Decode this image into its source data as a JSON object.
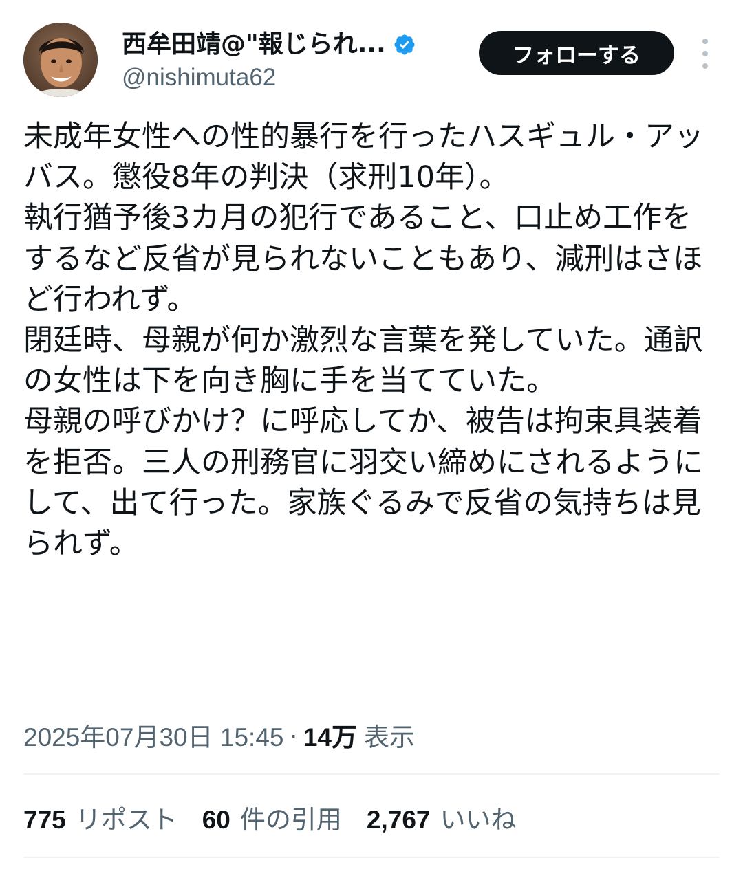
{
  "author": {
    "display_name": "西牟田靖@\"報じられ...",
    "handle": "@nishimuta62",
    "verified": true,
    "verified_color": "#1d9bf0"
  },
  "actions": {
    "follow_label": "フォローする",
    "more_icon": "more-vertical-icon"
  },
  "tweet": {
    "text": "未成年女性への性的暴行を行ったハスギュル・アッバス。懲役8年の判決（求刑10年）。\n執行猶予後3カ月の犯行であること、口止め工作をするなど反省が見られないこともあり、減刑はさほど行われず。\n閉廷時、母親が何か激烈な言葉を発していた。通訳の女性は下を向き胸に手を当てていた。\n母親の呼びかけ？に呼応してか、被告は拘束具装着を拒否。三人の刑務官に羽交い締めにされるようにして、出て行った。家族ぐるみで反省の気持ちは見られず。",
    "timestamp": "2025年07月30日 15:45",
    "separator": "·",
    "views_count": "14万",
    "views_label": "表示"
  },
  "stats": [
    {
      "count": "775",
      "label": "リポスト"
    },
    {
      "count": "60",
      "label": "件の引用"
    },
    {
      "count": "2,767",
      "label": "いいね"
    }
  ],
  "colors": {
    "text_primary": "#0f1419",
    "text_secondary": "#536471",
    "follow_button_bg": "#0f1419",
    "divider": "#eff3f4"
  }
}
